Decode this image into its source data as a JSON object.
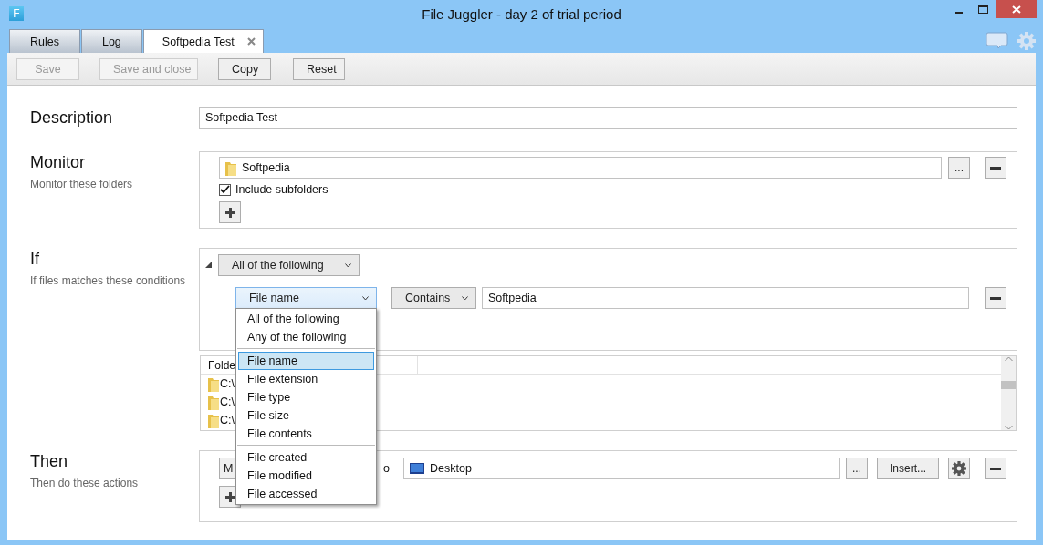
{
  "window": {
    "title": "File Juggler - day 2 of trial period",
    "app_icon": "F"
  },
  "tabs": [
    {
      "label": "Rules",
      "selected": false,
      "closable": false
    },
    {
      "label": "Log",
      "selected": false,
      "closable": false
    },
    {
      "label": "Softpedia Test",
      "selected": true,
      "closable": true
    }
  ],
  "toolbar": [
    {
      "label": "Save",
      "disabled": true
    },
    {
      "label": "Save and close",
      "disabled": true
    },
    {
      "label": "Copy",
      "disabled": false
    },
    {
      "label": "Reset",
      "disabled": false
    }
  ],
  "description": {
    "label": "Description",
    "value": "Softpedia Test"
  },
  "monitor": {
    "title": "Monitor",
    "subtitle": "Monitor these folders",
    "folder": "Softpedia",
    "browse": "...",
    "include_subfolders": {
      "label": "Include subfolders",
      "checked": true
    }
  },
  "conditions": {
    "title": "If",
    "subtitle": "If files matches these conditions",
    "expanded": true,
    "group_mode": "All of the following",
    "property": "File name",
    "operator": "Contains",
    "value": "Softpedia"
  },
  "preview_table": {
    "columns": [
      "Folde"
    ],
    "rows": [
      "C:\\",
      "C:\\",
      "C:\\"
    ]
  },
  "actions": {
    "title": "Then",
    "subtitle": "Then do these actions",
    "action": "M",
    "connector": "o",
    "target": "Desktop",
    "browse": "...",
    "insert": "Insert..."
  },
  "dropdown_menu": {
    "groups": [
      [
        {
          "label": "All of the following",
          "selected": false
        },
        {
          "label": "Any of the following",
          "selected": false
        }
      ],
      [
        {
          "label": "File name",
          "selected": true
        },
        {
          "label": "File extension",
          "selected": false
        },
        {
          "label": "File type",
          "selected": false
        },
        {
          "label": "File size",
          "selected": false
        },
        {
          "label": "File contents",
          "selected": false
        }
      ],
      [
        {
          "label": "File created",
          "selected": false
        },
        {
          "label": "File modified",
          "selected": false
        },
        {
          "label": "File accessed",
          "selected": false
        }
      ]
    ]
  }
}
